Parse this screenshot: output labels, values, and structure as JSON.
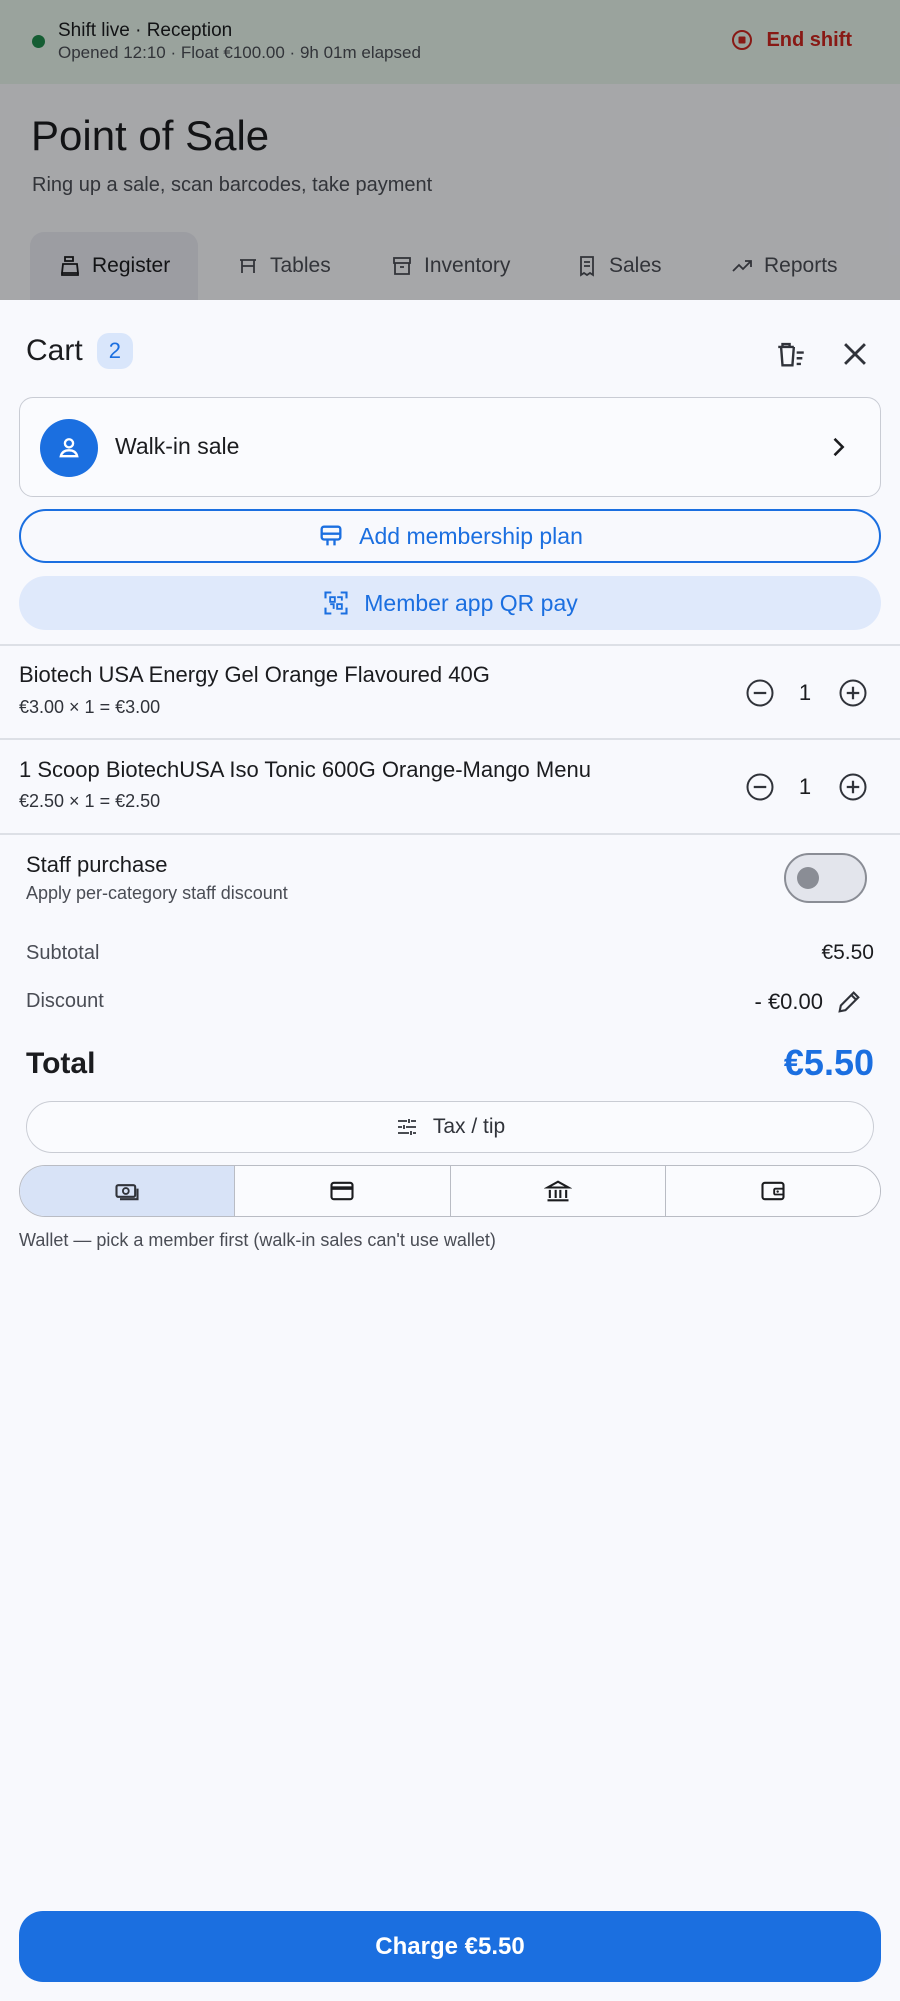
{
  "background": {
    "shift_title": "Shift live · Reception",
    "shift_sub": "Opened 12:10 · Float €100.00 · 9h 01m elapsed",
    "end_shift_label": "End shift",
    "page_title": "Point of Sale",
    "page_subtitle": "Ring up a sale, scan barcodes, take payment",
    "tabs": [
      {
        "label": "Register",
        "icon": "register-icon",
        "active": true
      },
      {
        "label": "Tables",
        "icon": "table-icon",
        "active": false
      },
      {
        "label": "Inventory",
        "icon": "inventory-icon",
        "active": false
      },
      {
        "label": "Sales",
        "icon": "receipt-icon",
        "active": false
      },
      {
        "label": "Reports",
        "icon": "trend-icon",
        "active": false
      }
    ]
  },
  "cart": {
    "title": "Cart",
    "count": "2",
    "customer": "Walk-in sale",
    "add_membership_label": "Add membership plan",
    "qr_pay_label": "Member app QR pay",
    "items": [
      {
        "name": "Biotech USA Energy Gel Orange Flavoured 40G",
        "price_line": "€3.00 × 1 = €3.00",
        "qty": "1"
      },
      {
        "name": "1 Scoop BiotechUSA Iso Tonic 600G Orange-Mango Menu",
        "price_line": "€2.50 × 1 = €2.50",
        "qty": "1"
      }
    ],
    "staff_purchase": {
      "title": "Staff purchase",
      "subtitle": "Apply per-category staff discount",
      "enabled": false
    },
    "subtotal_label": "Subtotal",
    "subtotal_value": "€5.50",
    "discount_label": "Discount",
    "discount_value": "- €0.00",
    "total_label": "Total",
    "total_value": "€5.50",
    "tax_tip_label": "Tax / tip",
    "payment_methods": [
      {
        "icon": "cash-icon",
        "selected": true
      },
      {
        "icon": "card-icon",
        "selected": false
      },
      {
        "icon": "bank-icon",
        "selected": false
      },
      {
        "icon": "wallet-icon",
        "selected": false
      }
    ],
    "wallet_note": "Wallet — pick a member first (walk-in sales can't use wallet)",
    "charge_label": "Charge €5.50"
  },
  "colors": {
    "accent": "#1b6fe0",
    "danger": "#c9251f",
    "live": "#1f8a4c"
  }
}
